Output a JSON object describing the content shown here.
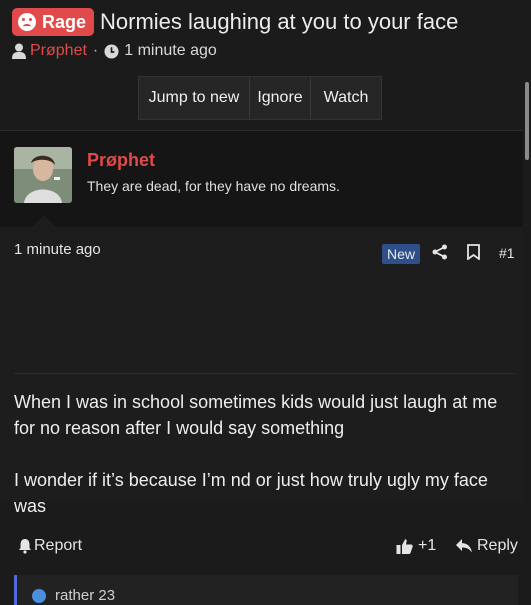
{
  "thread": {
    "prefix": "Rage",
    "title": "Normies laughing at you to your face",
    "starter": "Prøphet",
    "started": "1 minute ago"
  },
  "toolbar": {
    "jump_label": "Jump to new",
    "ignore_label": "Ignore",
    "watch_label": "Watch"
  },
  "post": {
    "author": "Prøphet",
    "user_title": "They are dead, for they have no dreams.",
    "time": "1 minute ago",
    "badge": "New",
    "number": "#1",
    "paragraph1": "When I was in school sometimes kids would just laugh at me for no reason after I would say something",
    "paragraph2": "I wonder if it’s because I’m nd or just how truly ugly my face was",
    "report_label": "Report",
    "like_count": "+1",
    "reply_label": "Reply",
    "quote_attr": "rather 23"
  },
  "colors": {
    "accent": "#e14a4a",
    "new_badge": "#2d4f8a",
    "quote_bar": "#4f6bd8"
  },
  "icons": [
    "rage-icon",
    "user-icon",
    "clock-icon",
    "share-icon",
    "bookmark-icon",
    "bell-icon",
    "thumbs-up-icon",
    "reply-icon"
  ]
}
